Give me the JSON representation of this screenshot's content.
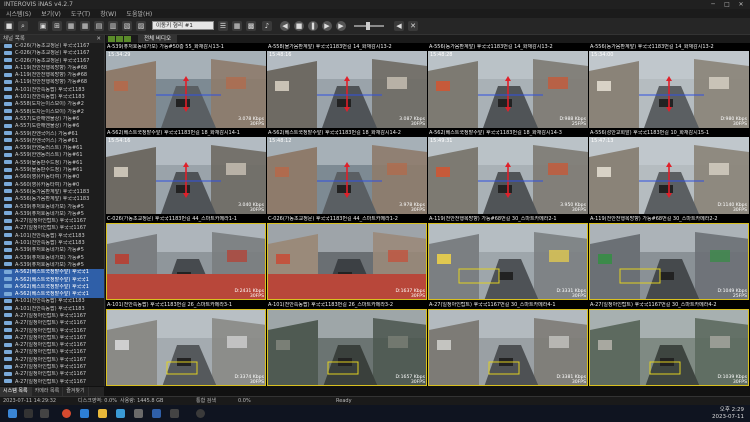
{
  "window": {
    "title": "INTEROVIS iNAS v4.2.7"
  },
  "menu": [
    "시스템(S)",
    "보기(V)",
    "도구(T)",
    "창(W)",
    "도움말(H)"
  ],
  "toolbar": {
    "search_placeholder": "이동키 형리 #1"
  },
  "sidebar": {
    "title": "채널 목록",
    "items": [
      "C-026(가동초교정문) 후국국1167",
      "C-026(가동초교정문) 후국국1167",
      "C-026(가동초교정문) 후국국1167",
      "A-119(천안천행복방향) 가능#68",
      "A-119(천안천행복방향) 가능#68",
      "A-119(천안천행복방향) 가능#68",
      "A-101(천안쪽동팝) 후국국1183",
      "A-101(천안쪽동팝) 후국국1183",
      "A-558(도차는이스보이) 가능#2",
      "A-558(도차는이스보이) 가능#2",
      "A-557(도란해엔물상) 가능#6",
      "A-557(도란해엔물상) 가능#6",
      "A-559(찬엔국어스) 가능#61",
      "A-559(찬엔국어스) 가능#61",
      "A-559(한엔동러스트) 가능#61",
      "A-559(한엔동러스트) 가능#61",
      "A-559(물동판수드청) 가능#61",
      "A-559(물동판수드청) 가능#61",
      "A-560(영유카동타여) 가능#0",
      "A-560(영유카동타여) 가능#0",
      "A-556(동가음환계앞) 후국국1183",
      "A-556(동가음환계앞) 후국국1183",
      "A-539(퓨처호동네가보) 가능#5",
      "A-539(퓨처호동네가보) 가능#5",
      "A-27(일정아인탑트) 후국국1167",
      "A-27(일정아인탑트) 후국국1167",
      "A-101(천안쪽동팝) 후국국1183",
      "A-101(천안쪽동팝) 후국국1183",
      "A-539(퓨처호동네가보) 가능#5",
      "A-539(퓨처호동네가보) 가능#5",
      "A-539(퓨처호동네가보) 가능#5",
      "A-562(베스트쿡정밭수앞) 후국국1",
      "A-562(베스트쿡정밭수앞) 후국국1",
      "A-562(베스트쿡정밭수앞) 후국국1",
      "A-562(베스트쿡정밭수앞) 후국국1",
      "A-101(천안쪽동팝) 후국국1183",
      "A-101(천안쪽동팝) 후국국1183",
      "A-27(일정아인탑트) 후국국1167",
      "A-27(일정아인탑트) 후국국1167",
      "A-27(일정아인탑트) 후국국1167",
      "A-27(일정아인탑트) 후국국1167",
      "A-27(일정아인탑트) 후국국1167",
      "A-27(일정아인탑트) 후국국1167",
      "A-27(일정아인탑트) 후국국1167",
      "A-27(일정아인탑트) 후국국1167",
      "A-27(일정아인탑트) 후국국1167",
      "A-27(일정아인탑트) 후국국1167"
    ],
    "tabs": [
      "시스템 목록",
      "카메라 목록",
      "즐겨찾기"
    ]
  },
  "main": {
    "tab_label": "전체 비디오",
    "tiles": [
      {
        "label": "A-539(퓨처호동네가보) 가능#50층 55_화재감시13-1",
        "time": "15:34:29",
        "kbps": "3.078 Kbps",
        "fps": "30FPS",
        "variant": 0
      },
      {
        "label": "A-558(물가음환계앞) 후국국1183번길 14_화재감시13-2",
        "time": "15:48:16",
        "kbps": "3.087 Kbps",
        "fps": "30FPS",
        "variant": 1
      },
      {
        "label": "A-556(동가음환계앞) 후국국1183번길 14_화재감시13-2",
        "time": "15:48:28",
        "kbps": "D:988 Kbps",
        "fps": "25FPS",
        "variant": 2
      },
      {
        "label": "A-556(동가음환계앞) 후국국1183번길 14_화재감시13-2",
        "time": "15:34:00",
        "kbps": "D:980 Kbps",
        "fps": "30FPS",
        "variant": 3
      },
      {
        "label": "A-562(베스트쿡정밭수앞) 후국국1183번길 18_화재감시14-1",
        "time": "15:54:16",
        "kbps": "3.040 Kbps",
        "fps": "30FPS",
        "variant": 1
      },
      {
        "label": "A-562(베스트쿡정밭수앞) 후국국1183번길 18_화재감시14-2",
        "time": "15:48:12",
        "kbps": "3.978 Kbps",
        "fps": "30FPS",
        "variant": 0
      },
      {
        "label": "A-562(베스트쿡정밭수앞) 후국국1183번길 18_화재감시14-3",
        "time": "15:49:31",
        "kbps": "3.950 Kbps",
        "fps": "30FPS",
        "variant": 2
      },
      {
        "label": "A-556(성안교회앞) 후국국1183번길 10_화재감시15-1",
        "time": "15:47:13",
        "kbps": "D:1140 Kbps",
        "fps": "30FPS",
        "variant": 3
      },
      {
        "label": "C-026(가동초교정문) 후국국1183번길 44_스마트카메라1-1",
        "time": "",
        "kbps": "D:2431 Kbps",
        "fps": "30FPS",
        "variant": 4
      },
      {
        "label": "C-026(가동초교정문) 후국국1183번길 44_스마트카메라1-2",
        "time": "",
        "kbps": "D:1637 Kbps",
        "fps": "30FPS",
        "variant": 5
      },
      {
        "label": "A-119(천안천행복방향) 가능#68번길 30_스마트카메라2-1",
        "time": "",
        "kbps": "D:3331 Kbps",
        "fps": "30FPS",
        "variant": 6
      },
      {
        "label": "A-119(천안천행복방향) 가능#68번길 30_스마트카메라2-2",
        "time": "",
        "kbps": "D:1049 Kbps",
        "fps": "25FPS",
        "variant": 7
      },
      {
        "label": "A-101(천안쪽동팝) 후국국1183번길 26_스마트카메라3-1",
        "time": "",
        "kbps": "D:3374 Kbps",
        "fps": "30FPS",
        "variant": 8
      },
      {
        "label": "A-101(천안쪽동팝) 후국국1183번길 26_스마트카메라3-2",
        "time": "",
        "kbps": "D:1657 Kbps",
        "fps": "30FPS",
        "variant": 9
      },
      {
        "label": "A-27(일정아인탑트) 후국국1167번길 30_스마트카메라4-1",
        "time": "",
        "kbps": "D:3381 Kbps",
        "fps": "30FPS",
        "variant": 10
      },
      {
        "label": "A-27(일정아인탑트) 후국국1167번길 30_스마트카메라4-2",
        "time": "",
        "kbps": "D:1039 Kbps",
        "fps": "30FPS",
        "variant": 11
      }
    ]
  },
  "statusbar": {
    "disk": "디스크영역: 0.0%",
    "usage": "사용량: 1445.8 GB",
    "total": "통합 검색",
    "progress": "0.0%",
    "status": "Ready",
    "datetime": "2023-07-11 14:29:32"
  },
  "taskbar": {
    "time": "오후 2:29",
    "date": "2023-07-11"
  }
}
